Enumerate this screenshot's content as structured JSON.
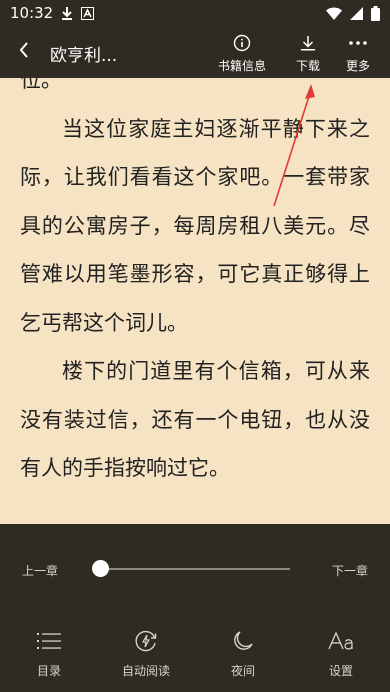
{
  "status_bar": {
    "time": "10:32",
    "download_icon": "download-icon",
    "app_icon": "a-icon",
    "wifi_icon": "wifi-icon",
    "signal_icon": "signal-icon",
    "battery_icon": "battery-icon"
  },
  "toolbar": {
    "back_icon": "chevron-left-icon",
    "title": "欧亨利...",
    "items": [
      {
        "label": "书籍信息",
        "icon": "info-icon"
      },
      {
        "label": "下载",
        "icon": "download-icon"
      },
      {
        "label": "更多",
        "icon": "more-dots-icon"
      }
    ]
  },
  "reader": {
    "paragraphs": [
      {
        "text": "位。",
        "indent": false
      },
      {
        "text": "当这位家庭主妇逐渐平静下来之际，让我们看看这个家吧。一套带家具的公寓房子，每周房租八美元。尽管难以用笔墨形容，可它真正够得上乞丐帮这个词儿。",
        "indent": true
      },
      {
        "text": "楼下的门道里有个信箱，可从来没有装过信，还有一个电钮，也从没有人的手指按响过它。",
        "indent": true
      }
    ]
  },
  "bottom": {
    "prev_chapter": "上一章",
    "next_chapter": "下一章",
    "progress": 0.0,
    "nav": [
      {
        "label": "目录",
        "icon": "list-icon"
      },
      {
        "label": "自动阅读",
        "icon": "auto-read-icon"
      },
      {
        "label": "夜间",
        "icon": "moon-icon"
      },
      {
        "label": "设置",
        "icon": "font-settings-icon"
      }
    ]
  },
  "colors": {
    "bar_bg": "#2f2b22",
    "page_bg": "#f6e3c3",
    "annotation": "#e53935"
  }
}
